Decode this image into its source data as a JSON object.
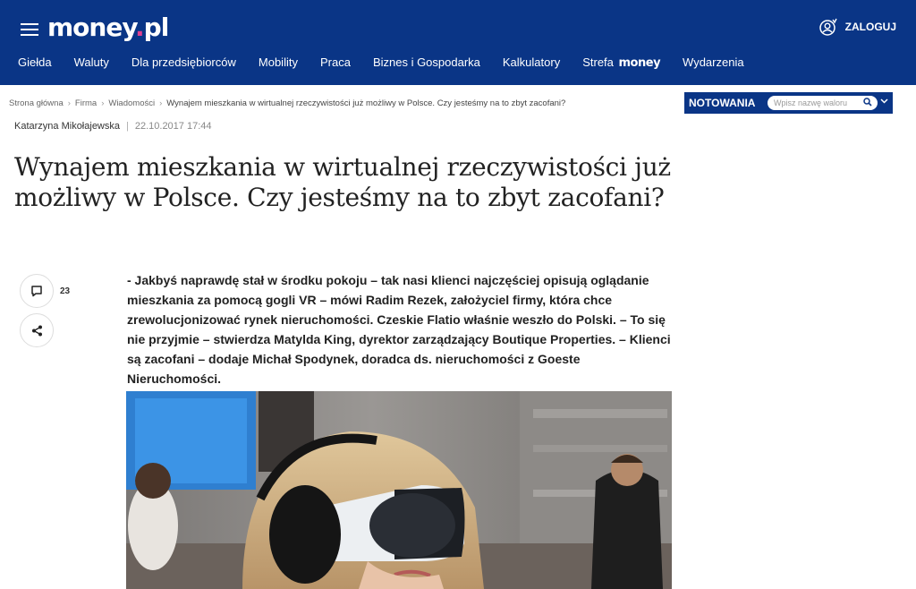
{
  "header": {
    "logo_main": "money",
    "logo_dot": ".",
    "logo_tld": "pl",
    "login_label": "ZALOGUJ"
  },
  "nav": {
    "items": [
      "Giełda",
      "Waluty",
      "Dla przedsiębiorców",
      "Mobility",
      "Praca",
      "Biznes i Gospodarka",
      "Kalkulatory"
    ],
    "strefa_label": "Strefa",
    "strefa_brand": "money",
    "events": "Wydarzenia"
  },
  "breadcrumb": {
    "items": [
      "Strona główna",
      "Firma",
      "Wiadomości"
    ],
    "current": "Wynajem mieszkania w wirtualnej rzeczywistości już możliwy w Polsce. Czy jesteśmy na to zbyt zacofani?"
  },
  "quotes": {
    "label": "NOTOWANIA",
    "placeholder": "Wpisz nazwę waloru"
  },
  "article": {
    "author": "Katarzyna Mikołajewska",
    "date": "22.10.2017 17:44",
    "title": "Wynajem mieszkania w wirtualnej rzeczywistości już możliwy w Polsce. Czy jesteśmy na to zbyt zacofani?",
    "lead": "- Jakbyś naprawdę stał w środku pokoju – tak nasi klienci najczęściej opisują oglądanie mieszkania za pomocą gogli VR – mówi Radim Rezek, założyciel firmy, która chce zrewolucjonizować rynek nieruchomości. Czeskie Flatio właśnie weszło do Polski. – To się nie przyjmie – stwierdza Matylda King, dyrektor zarządzający Boutique Properties. – Klienci są zacofani – dodaje Michał Spodynek, doradca ds. nieruchomości z Goeste Nieruchomości.",
    "comment_count": "23"
  },
  "colors": {
    "brand_blue": "#0a3586",
    "logo_accent": "#e0418f"
  }
}
